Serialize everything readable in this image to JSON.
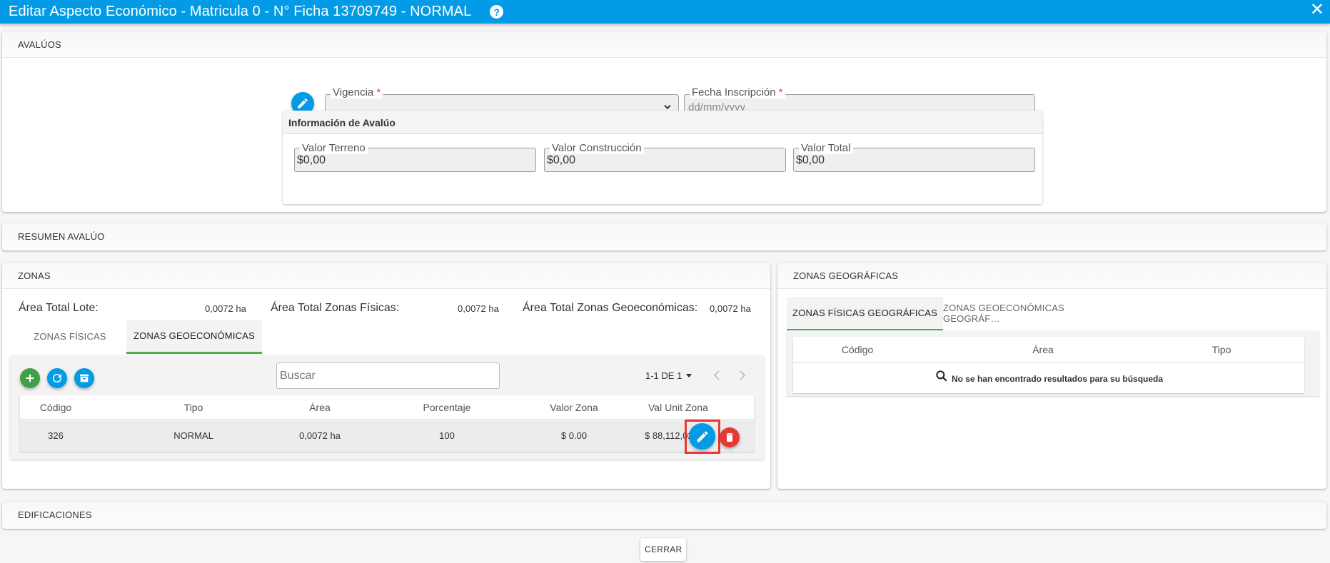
{
  "window": {
    "title": "Editar Aspecto Económico - Matricula 0 - N° Ficha 13709749 - NORMAL",
    "help_glyph": "?",
    "close_glyph": "✕"
  },
  "avaluos": {
    "header": "AVALÚOS",
    "vigencia_label": "Vigencia",
    "fecha_label": "Fecha Inscripción",
    "fecha_placeholder": "dd/mm/yyyy",
    "required_mark": "*",
    "info_title": "Información de Avalúo",
    "valor_terreno_label": "Valor Terreno",
    "valor_terreno": "$0,00",
    "valor_construccion_label": "Valor Construcción",
    "valor_construccion": "$0,00",
    "valor_total_label": "Valor Total",
    "valor_total": "$0,00"
  },
  "resumen": {
    "header": "RESUMEN AVALÚO"
  },
  "zonas": {
    "header": "ZONAS",
    "area_lote_label": "Área Total Lote:",
    "area_lote": "0,0072 ha",
    "area_fisicas_label": "Área Total Zonas Físicas:",
    "area_fisicas": "0,0072 ha",
    "area_geo_label": "Área Total Zonas Geoeconómicas:",
    "area_geo": "0,0072 ha",
    "tabs": [
      "ZONAS FÍSICAS",
      "ZONAS GEOECONÓMICAS"
    ],
    "search_placeholder": "Buscar",
    "pager": "1-1 DE 1",
    "columns": [
      "Código",
      "Tipo",
      "Área",
      "Porcentaje",
      "Valor Zona",
      "Val Unit Zona"
    ],
    "rows": [
      {
        "codigo": "326",
        "tipo": "NORMAL",
        "area": "0,0072 ha",
        "porcentaje": "100",
        "valor_zona": "$ 0.00",
        "val_unit": "$ 88,112,023"
      }
    ]
  },
  "zonas_geo": {
    "header": "ZONAS GEOGRÁFICAS",
    "tabs": [
      "ZONAS FÍSICAS GEOGRÁFICAS",
      "ZONAS GEOECONÓMICAS GEOGRÁF…"
    ],
    "columns": [
      "Código",
      "Área",
      "Tipo"
    ],
    "empty_message": "No se han encontrado resultados para su búsqueda"
  },
  "edificaciones": {
    "header": "EDIFICACIONES"
  },
  "footer": {
    "close_button": "CERRAR"
  },
  "colors": {
    "primary": "#039be5",
    "success": "#43a047",
    "danger": "#e53935",
    "highlight": "#e53935"
  }
}
